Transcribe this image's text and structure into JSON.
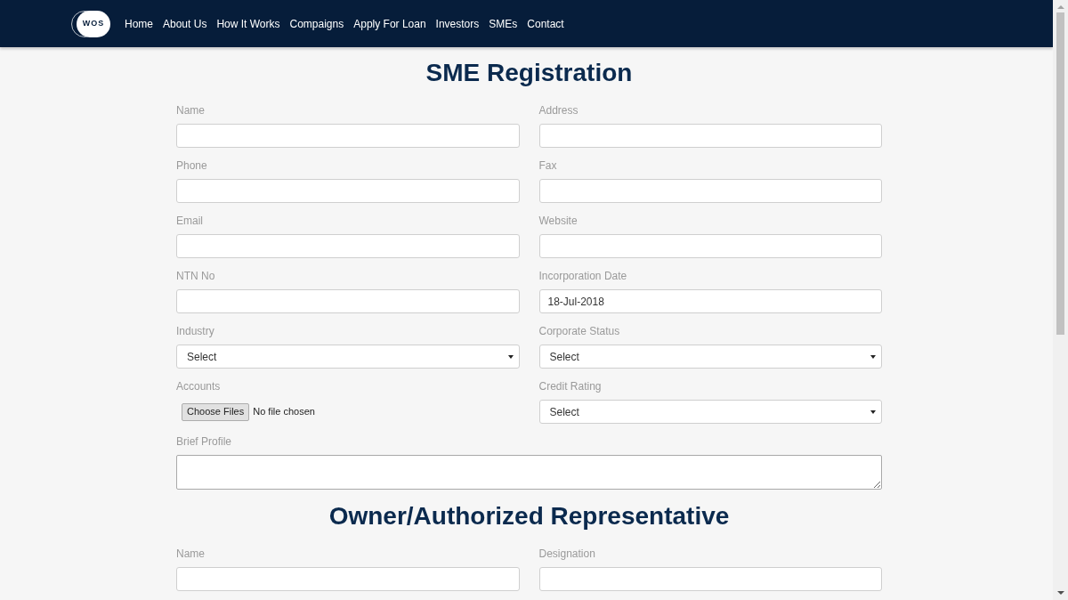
{
  "navbar": {
    "logo_text": "WOS",
    "items": [
      {
        "label": "Home"
      },
      {
        "label": "About Us"
      },
      {
        "label": "How It Works"
      },
      {
        "label": "Compaigns"
      },
      {
        "label": "Apply For Loan"
      },
      {
        "label": "Investors"
      },
      {
        "label": "SMEs"
      },
      {
        "label": "Contact"
      }
    ]
  },
  "sections": [
    {
      "title": "SME Registration",
      "fields": [
        {
          "kind": "text",
          "label": "Name"
        },
        {
          "kind": "text",
          "label": "Address"
        },
        {
          "kind": "text",
          "label": "Phone"
        },
        {
          "kind": "text",
          "label": "Fax"
        },
        {
          "kind": "text",
          "label": "Email"
        },
        {
          "kind": "text",
          "label": "Website"
        },
        {
          "kind": "text",
          "label": "NTN No"
        },
        {
          "kind": "text",
          "label": "Incorporation Date",
          "value": "18-Jul-2018"
        },
        {
          "kind": "select",
          "label": "Industry",
          "value": "Select"
        },
        {
          "kind": "select",
          "label": "Corporate Status",
          "value": "Select"
        },
        {
          "kind": "file",
          "label": "Accounts",
          "button": "Choose Files",
          "status": "No file chosen"
        },
        {
          "kind": "select",
          "label": "Credit Rating",
          "value": "Select"
        },
        {
          "kind": "textarea",
          "label": "Brief Profile"
        }
      ]
    },
    {
      "title": "Owner/Authorized Representative",
      "fields": [
        {
          "kind": "text",
          "label": "Name"
        },
        {
          "kind": "text",
          "label": "Designation"
        }
      ]
    }
  ]
}
